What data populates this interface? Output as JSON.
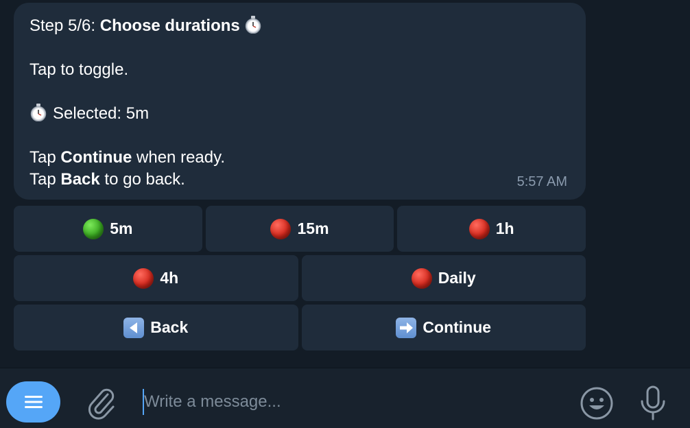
{
  "message": {
    "step_prefix": "Step 5/6: ",
    "step_title": "Choose durations",
    "instruction": "Tap to toggle.",
    "selected_label": "Selected: 5m",
    "continue_pre": "Tap ",
    "continue_word": "Continue",
    "continue_post": " when ready.",
    "back_pre": "Tap ",
    "back_word": "Back",
    "back_post": " to go back.",
    "time": "5:57 AM",
    "icon": "stopwatch-icon"
  },
  "keyboard": {
    "rows": [
      [
        {
          "label": "5m",
          "status": "selected",
          "icon": "green-circle-icon"
        },
        {
          "label": "15m",
          "status": "unselected",
          "icon": "red-circle-icon"
        },
        {
          "label": "1h",
          "status": "unselected",
          "icon": "red-circle-icon"
        }
      ],
      [
        {
          "label": "4h",
          "status": "unselected",
          "icon": "red-circle-icon"
        },
        {
          "label": "Daily",
          "status": "unselected",
          "icon": "red-circle-icon"
        }
      ],
      [
        {
          "label": "Back",
          "icon": "back-arrow-icon"
        },
        {
          "label": "Continue",
          "icon": "right-arrow-icon"
        }
      ]
    ]
  },
  "composer": {
    "placeholder": "Write a message...",
    "value": ""
  },
  "colors": {
    "background": "#131c26",
    "bubble": "#1f2c3b",
    "accent": "#55a6f7",
    "selected": "#3aa821",
    "unselected": "#d42a1e"
  }
}
